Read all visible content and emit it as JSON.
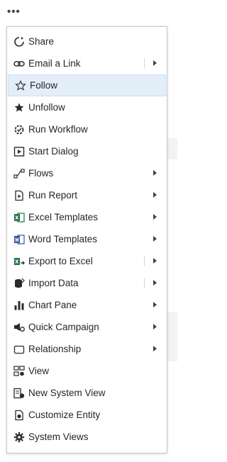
{
  "more_glyph": "•••",
  "menu": {
    "items": [
      {
        "label": "Share",
        "icon": "share-icon",
        "submenu": false
      },
      {
        "label": "Email a Link",
        "icon": "link-icon",
        "submenu": true,
        "divider": true
      },
      {
        "label": "Follow",
        "icon": "star-outline-icon",
        "submenu": false,
        "highlight": true
      },
      {
        "label": "Unfollow",
        "icon": "star-filled-icon",
        "submenu": false
      },
      {
        "label": "Run Workflow",
        "icon": "workflow-icon",
        "submenu": false
      },
      {
        "label": "Start Dialog",
        "icon": "dialog-icon",
        "submenu": false
      },
      {
        "label": "Flows",
        "icon": "flows-icon",
        "submenu": true
      },
      {
        "label": "Run Report",
        "icon": "report-icon",
        "submenu": true
      },
      {
        "label": "Excel Templates",
        "icon": "excel-icon",
        "submenu": true
      },
      {
        "label": "Word Templates",
        "icon": "word-icon",
        "submenu": true
      },
      {
        "label": "Export to Excel",
        "icon": "export-excel-icon",
        "submenu": true,
        "divider": true
      },
      {
        "label": "Import Data",
        "icon": "import-data-icon",
        "submenu": true,
        "divider": true
      },
      {
        "label": "Chart Pane",
        "icon": "chart-icon",
        "submenu": true
      },
      {
        "label": "Quick Campaign",
        "icon": "campaign-icon",
        "submenu": true
      },
      {
        "label": "Relationship",
        "icon": "relationship-icon",
        "submenu": true
      },
      {
        "label": "View",
        "icon": "view-icon",
        "submenu": false
      },
      {
        "label": "New System View",
        "icon": "new-view-icon",
        "submenu": false
      },
      {
        "label": "Customize Entity",
        "icon": "customize-icon",
        "submenu": false
      },
      {
        "label": "System Views",
        "icon": "gear-icon",
        "submenu": false
      }
    ]
  },
  "colors": {
    "highlight": "#e3eef9",
    "icon": "#2b2b2b",
    "excel": "#217346",
    "word": "#2b579a"
  }
}
